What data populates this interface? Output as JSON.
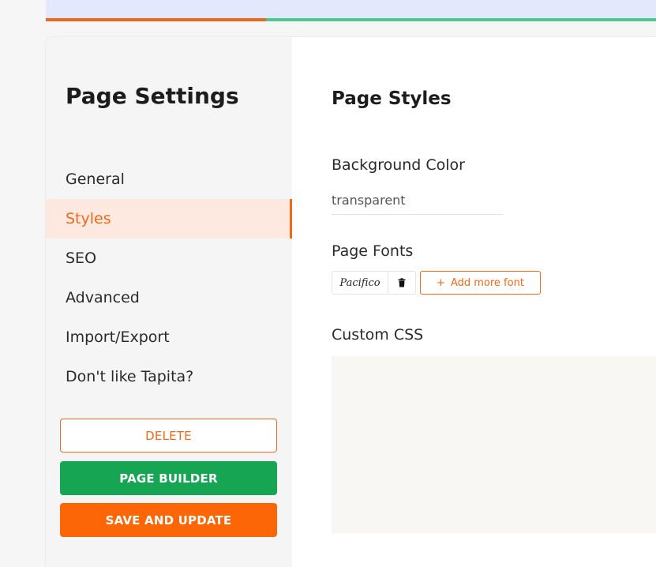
{
  "sidebar": {
    "title": "Page Settings",
    "items": [
      {
        "label": "General"
      },
      {
        "label": "Styles"
      },
      {
        "label": "SEO"
      },
      {
        "label": "Advanced"
      },
      {
        "label": "Import/Export"
      },
      {
        "label": "Don't like Tapita?"
      }
    ],
    "active_index": 1,
    "buttons": {
      "delete": "DELETE",
      "page_builder": "PAGE BUILDER",
      "save_update": "SAVE AND UPDATE"
    }
  },
  "main": {
    "title": "Page Styles",
    "background": {
      "label": "Background Color",
      "value": "transparent"
    },
    "fonts": {
      "label": "Page Fonts",
      "items": [
        {
          "name": "Pacifico"
        }
      ],
      "add_label": "Add more font"
    },
    "custom_css": {
      "label": "Custom CSS",
      "value": ""
    }
  },
  "colors": {
    "accent": "#ec6a1c",
    "green": "#16a553",
    "save": "#fd6606",
    "progress_done": "#ec6a1c",
    "progress_rest": "#4cc893"
  },
  "icons": {
    "add": "plus-icon",
    "remove_font": "trash-icon"
  }
}
